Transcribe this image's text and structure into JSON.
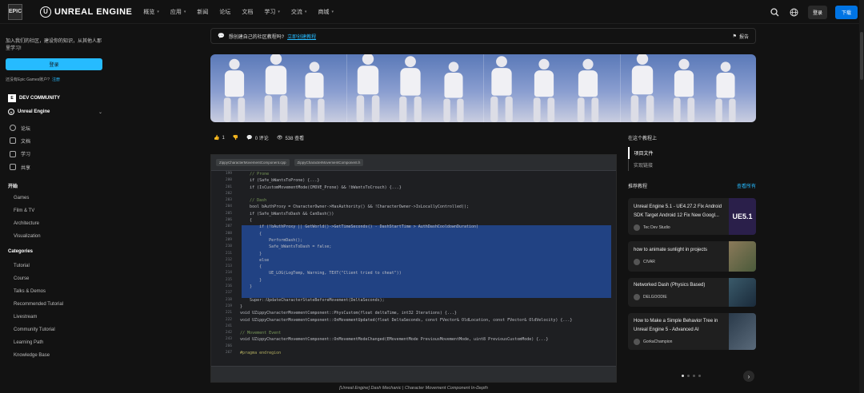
{
  "topbar": {
    "epic_logo": "EPIC",
    "brand": "UNREAL ENGINE",
    "nav": [
      {
        "label": "概览",
        "has_menu": true
      },
      {
        "label": "应用",
        "has_menu": true
      },
      {
        "label": "新闻",
        "has_menu": false
      },
      {
        "label": "论坛",
        "has_menu": false
      },
      {
        "label": "文档",
        "has_menu": false
      },
      {
        "label": "学习",
        "has_menu": true
      },
      {
        "label": "交流",
        "has_menu": true
      },
      {
        "label": "商城",
        "has_menu": true
      }
    ],
    "login": "登录",
    "download": "下载",
    "icons": [
      "search-icon",
      "globe-icon"
    ]
  },
  "sidebar": {
    "promo": "加入我们的社区，建设你的知识，从其他人那里学习!",
    "login": "登录",
    "no_account": "还没有Epic Games账户?",
    "register": "注册",
    "dev_community": "DEV COMMUNITY",
    "engine": "Unreal Engine",
    "subnav": [
      "论坛",
      "文档",
      "学习",
      "共享"
    ],
    "section_start": "开始",
    "start_items": [
      "Games",
      "Film & TV",
      "Architecture",
      "Visualization"
    ],
    "section_categories": "Categories",
    "category_items": [
      "Tutorial",
      "Course",
      "Talks & Demos",
      "Recommended Tutorial",
      "Livestream",
      "Community Tutorial",
      "Learning Path",
      "Knowledge Base"
    ]
  },
  "main": {
    "notice_text": "想创建自己的社区教程吗?",
    "notice_link": "立即创建教程",
    "report": "报告",
    "stats": {
      "likes": "1",
      "comments": "0 评论",
      "views": "538 查看"
    },
    "code_lines": [
      "      // Prone",
      "      if (Safe_bWantsToProne) {...}",
      "      if (IsCustomMovementMode(CMOVE_Prone) && !bWantsToCrouch) {...}",
      "",
      "      // Dash",
      "      bool bAuthProxy = CharacterOwner->HasAuthority() && !CharacterOwner->IsLocallyControlled();",
      "      if (Safe_bWantsToDash && CanDash())",
      "      {",
      "          if (!bAuthProxy || GetWorld()->GetTimeSeconds() - DashStartTime > AuthDashCooldownDuration)",
      "          {",
      "              PerformDash();",
      "              Safe_bWantsToDash = false;",
      "          }",
      "          else",
      "          {",
      "              UE_LOG(LogTemp, Warning, TEXT(\"Client tried to cheat\"))",
      "          }",
      "      }",
      "",
      "      Super::UpdateCharacterStateBeforeMovement(DeltaSeconds);",
      "  }",
      "  void UZippyCharacterMovementComponent::PhysCustom(float deltaTime, int32 Iterations) {...}",
      "  void UZippyCharacterMovementComponent::OnMovementUpdated(float DeltaSeconds, const FVector& OldLocation, const FVector& OldVelocity) {...}",
      "",
      "  // Movement Event",
      "  void UZippyCharacterMovementComponent::OnMovementModeChanged(EMovementMode PreviousMovementMode, uint8 PreviousCustomMode) {...}",
      "",
      "  #pragma endregion"
    ],
    "line_numbers": [
      "199",
      "200",
      "201",
      "202",
      "203",
      "204",
      "205",
      "206",
      "207",
      "208",
      "209",
      "210",
      "211",
      "212",
      "213",
      "214",
      "215",
      "216",
      "217",
      "218",
      "219",
      "221",
      "222",
      "241",
      "242",
      "243",
      "266",
      "267"
    ],
    "caption": "[Unreal Engine] Dash Mechanic | Character Movement Component In-Depth"
  },
  "right": {
    "toc_heading": "在这个教程上",
    "toc": [
      "项目文件",
      "实现链接"
    ],
    "rec_heading": "推荐教程",
    "view_all": "查看所有",
    "cards": [
      {
        "title": "Unreal Engine 5.1 - UE4.27.2 Fix Android SDK Target Android 12 Fix New Googl...",
        "author": "Tec Dev Studio",
        "thumb": "UE5.1"
      },
      {
        "title": "how to animate sunlight in projects",
        "author": "CIVAR",
        "thumb": ""
      },
      {
        "title": "Networked Dash (Physics Based)",
        "author": "DELGOODIE",
        "thumb": ""
      },
      {
        "title": "How to Make a Simple Behavior Tree in Unreal Engine 5 - Advanced AI",
        "author": "GorkaChampion",
        "thumb": ""
      }
    ]
  }
}
